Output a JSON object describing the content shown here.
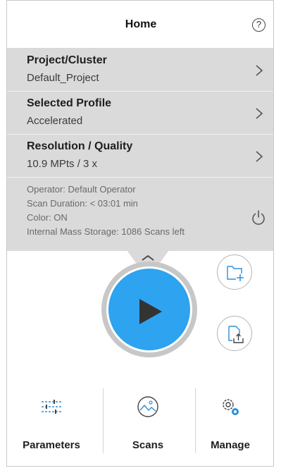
{
  "header": {
    "title": "Home",
    "help_icon": "help-circle-icon",
    "help_glyph": "?"
  },
  "settings": [
    {
      "label": "Project/Cluster",
      "value": "Default_Project"
    },
    {
      "label": "Selected Profile",
      "value": "Accelerated"
    },
    {
      "label": "Resolution / Quality",
      "value": "10.9 MPts / 3 x"
    }
  ],
  "info": {
    "operator": "Operator: Default Operator",
    "scan_duration": "Scan Duration: < 03:01 min",
    "color": "Color: ON",
    "storage": "Internal Mass Storage: 1086 Scans left"
  },
  "actions": {
    "play_icon": "play-icon",
    "new_folder_icon": "folder-add-icon",
    "export_icon": "file-export-icon"
  },
  "nav": [
    {
      "label": "Parameters",
      "icon": "sliders-icon"
    },
    {
      "label": "Scans",
      "icon": "image-icon"
    },
    {
      "label": "Manage",
      "icon": "gears-icon"
    }
  ],
  "colors": {
    "accent": "#2ea3ef",
    "panel_bg": "#dadada",
    "nav_icon": "#2f8fd6"
  }
}
